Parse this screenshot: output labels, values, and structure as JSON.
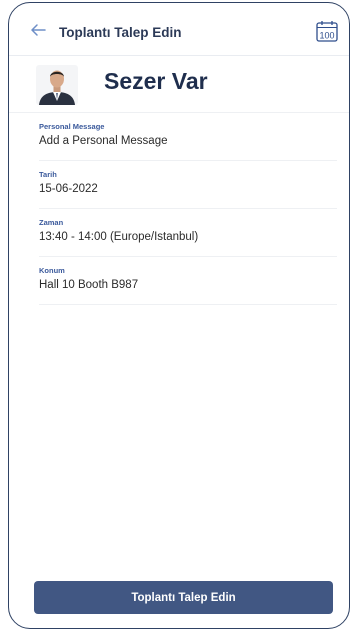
{
  "header": {
    "title": "Toplantı Talep Edin",
    "calendar_badge": "100"
  },
  "profile": {
    "name": "Sezer Var"
  },
  "fields": [
    {
      "label": "Personal Message",
      "value": "Add a Personal Message"
    },
    {
      "label": "Tarih",
      "value": "15-06-2022"
    },
    {
      "label": "Zaman",
      "value": "13:40 - 14:00  (Europe/Istanbul)"
    },
    {
      "label": "Konum",
      "value": "Hall 10 Booth B987"
    }
  ],
  "submit": {
    "label": "Toplantı Talep Edin"
  },
  "colors": {
    "accent": "#415783",
    "label_blue": "#3b5a9c",
    "frame": "#2f4264"
  }
}
